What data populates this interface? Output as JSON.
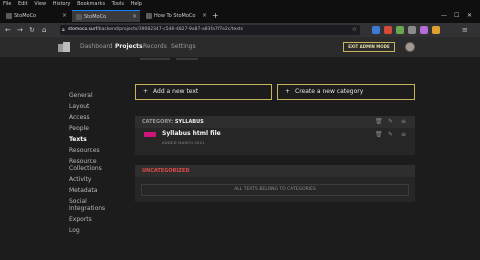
{
  "browser": {
    "menu": [
      "File",
      "Edit",
      "View",
      "History",
      "Bookmarks",
      "Tools",
      "Help"
    ],
    "tabs": [
      {
        "label": "StoMoCo"
      },
      {
        "label": "StoMoCo"
      },
      {
        "label": "How To StoMoCo"
      }
    ],
    "new_tab": "+",
    "url_host": "stomoco.surf",
    "url_path": "/backend/projects/39082347-c546-4827-9a87-a83fa7f7e2c/texts"
  },
  "app": {
    "nav": {
      "dashboard": "Dashboard",
      "projects": "Projects",
      "records": "Records",
      "settings": "Settings"
    },
    "exit_admin": "EXIT ADMIN MODE"
  },
  "sidebar": {
    "items": [
      {
        "label": "General"
      },
      {
        "label": "Layout"
      },
      {
        "label": "Access"
      },
      {
        "label": "People"
      },
      {
        "label": "Texts"
      },
      {
        "label": "Resources"
      },
      {
        "label": "Resource Collections"
      },
      {
        "label": "Activity"
      },
      {
        "label": "Metadata"
      },
      {
        "label": "Social Integrations"
      },
      {
        "label": "Exports"
      },
      {
        "label": "Log"
      }
    ]
  },
  "actions": {
    "add_text": "Add a new text",
    "create_category": "Create a new category",
    "plus": "+"
  },
  "category": {
    "prefix": "CATEGORY:",
    "name": "SYLLABUS",
    "text_title": "Syllabus html file",
    "text_date": "ADDED MARCH 2021"
  },
  "uncategorized": {
    "title": "UNCATEGORIZED",
    "empty_message": "ALL TEXTS BELONG TO CATEGORIES"
  },
  "colors": {
    "accent_gold": "#c8b45a",
    "badge_pink": "#d0157a",
    "uncat_red": "#e04a4a"
  }
}
